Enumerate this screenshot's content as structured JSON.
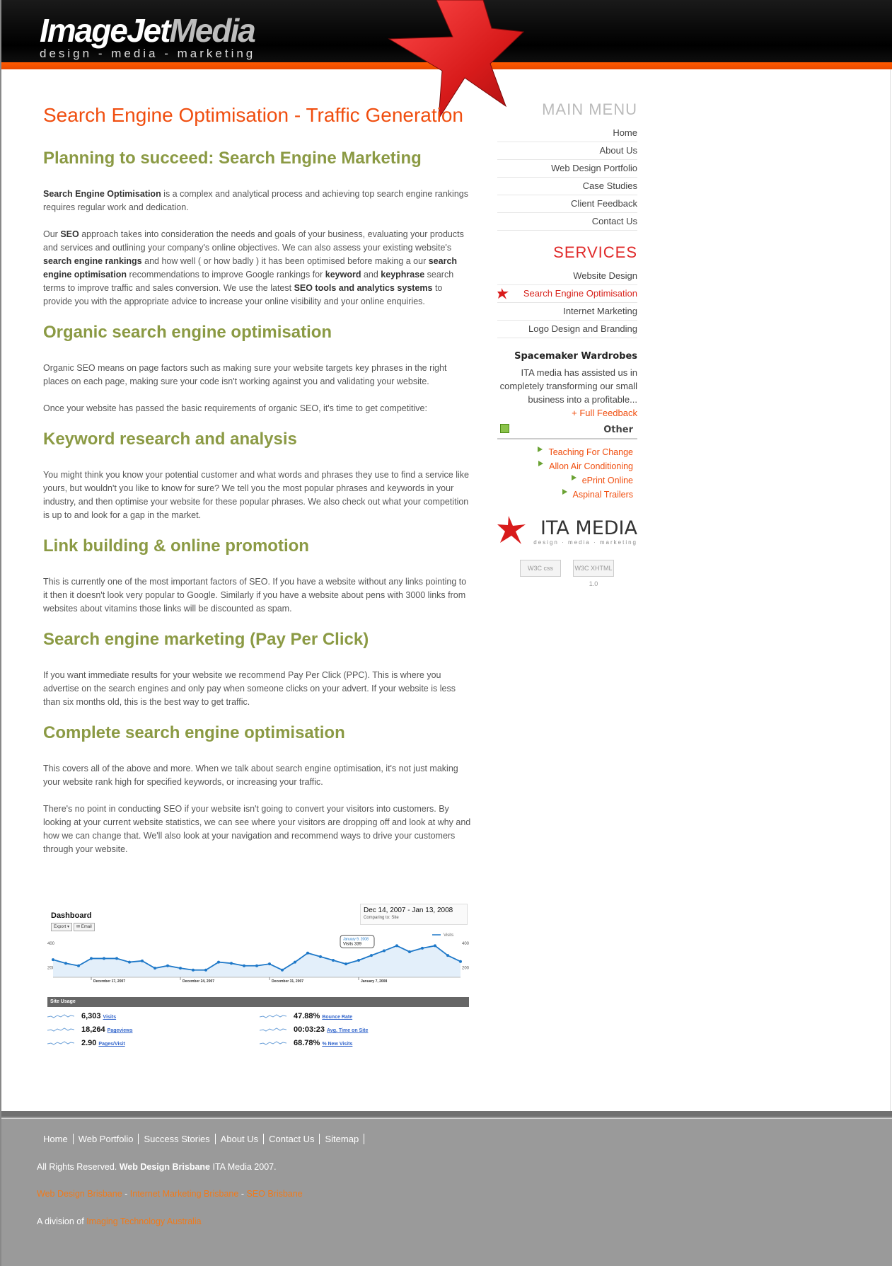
{
  "header": {
    "logo_main": "ImageJet",
    "logo_media": "Media",
    "logo_tagline": "design - media - marketing"
  },
  "main": {
    "page_title": "Search Engine Optimisation - Traffic Generation",
    "sections": [
      {
        "heading": "Planning to succeed: Search Engine Marketing",
        "paragraphs": [
          "<b>Search Engine Optimisation</b> is a complex and analytical process and achieving top search engine rankings requires regular work and dedication.",
          "Our <b>SEO</b> approach takes into consideration the needs and goals of your business, evaluating your products and services and outlining your company's online objectives. We can also assess your existing website's <b>search engine rankings</b> and how well ( or how badly ) it has been optimised before making a our <b>search engine optimisation</b> recommendations to improve Google rankings for <b>keyword</b> and <b>keyphrase</b> search terms to improve traffic and sales conversion. We use the latest <b>SEO tools and analytics systems</b> to provide you with the appropriate advice to increase your online visibility and your online enquiries."
        ]
      },
      {
        "heading": "Organic search engine optimisation",
        "paragraphs": [
          "Organic SEO means on page factors such as making sure your website targets key phrases in the right places on each page, making sure your code isn't working against you and validating your website.",
          "Once your website has passed the basic requirements of organic SEO, it's time to get competitive:"
        ]
      },
      {
        "heading": "Keyword research and analysis",
        "paragraphs": [
          "You might think you know your potential customer and what words and phrases they use to find a service like yours, but wouldn't you like to know for sure? We tell you the most popular phrases and keywords in your industry, and then optimise your website for these popular phrases. We also check out what your competition is up to and look for a gap in the market."
        ]
      },
      {
        "heading": "Link building & online promotion",
        "paragraphs": [
          "This is currently one of the most important factors of SEO. If you have a website without any links pointing to it then it doesn't look very popular to Google. Similarly if you have a website about pens with 3000 links from websites about vitamins those links will be discounted as spam."
        ]
      },
      {
        "heading": "Search engine marketing (Pay Per Click)",
        "paragraphs": [
          "If you want immediate results for your website we recommend Pay Per Click (PPC). This is where you advertise on the search engines and only pay when someone clicks on your advert. If your website is less than six months old, this is the best way to get traffic."
        ]
      },
      {
        "heading": "Complete search engine optimisation",
        "paragraphs": [
          "This covers all of the above and more. When we talk about search engine optimisation, it's not just making your website rank high for specified keywords, or increasing your traffic.",
          "There's no point in conducting SEO if your website isn't going to convert your visitors into customers. By looking at your current website statistics, we can see where your visitors are dropping off and look at why and how we can change that. We'll also look at your navigation and recommend ways to drive your customers through your website."
        ]
      }
    ]
  },
  "dashboard": {
    "title": "Dashboard",
    "export_label": "Export ▾",
    "email_label": "✉ Email",
    "date_range": "Dec 14, 2007 - Jan 13, 2008",
    "comparing": "Comparing to:  Site",
    "legend": "Visits",
    "tooltip_date": "January 9, 2008",
    "tooltip_value": "Visits 339",
    "y_labels": [
      "400",
      "200"
    ],
    "x_labels": [
      "December 17, 2007",
      "December 24, 2007",
      "December 31, 2007",
      "January 7, 2008"
    ],
    "usage_label": "Site Usage",
    "stats": [
      {
        "value": "6,303",
        "label": "Visits"
      },
      {
        "value": "18,264",
        "label": "Pageviews"
      },
      {
        "value": "2.90",
        "label": "Pages/Visit"
      },
      {
        "value": "47.88%",
        "label": "Bounce Rate"
      },
      {
        "value": "00:03:23",
        "label": "Avg. Time on Site"
      },
      {
        "value": "68.78%",
        "label": "% New Visits"
      }
    ]
  },
  "chart_data": {
    "type": "line",
    "series": [
      {
        "name": "Visits",
        "values": [
          265,
          235,
          215,
          275,
          275,
          275,
          245,
          255,
          195,
          215,
          195,
          180,
          180,
          245,
          235,
          215,
          215,
          230,
          180,
          245,
          320,
          290,
          260,
          230,
          260,
          300,
          339,
          380,
          330,
          360,
          380,
          300,
          250
        ]
      }
    ],
    "ylim": [
      0,
      400
    ],
    "x_ticks": [
      "December 17, 2007",
      "December 24, 2007",
      "December 31, 2007",
      "January 7, 2008"
    ]
  },
  "sidebar": {
    "main_menu_heading": "MAIN MENU",
    "main_menu": [
      "Home",
      "About Us",
      "Web Design Portfolio",
      "Case Studies",
      "Client Feedback",
      "Contact Us"
    ],
    "services_heading": "SERVICES",
    "services": [
      "Website Design",
      "Search Engine Optimisation",
      "Internet Marketing",
      "Logo Design and Branding"
    ],
    "testimonial": {
      "title": "Spacemaker Wardrobes",
      "body": "ITA media has assisted us in completely transforming our small business into a profitable...",
      "link": "+ Full Feedback"
    },
    "other_label": "Other",
    "other_links": [
      "Teaching For Change",
      "Allon Air Conditioning",
      "ePrint Online",
      "Aspinal Trailers"
    ],
    "ita_logo": "ITA MEDIA",
    "ita_tagline": "design · media · marketing",
    "w3c_css": "W3C css",
    "w3c_xhtml": "W3C XHTML 1.0"
  },
  "footer": {
    "nav": [
      "Home",
      "Web Portfolio",
      "Success Stories",
      "About Us",
      "Contact Us",
      "Sitemap"
    ],
    "copyright_prefix": "All Rights Reserved. ",
    "copyright_bold": "Web Design Brisbane",
    "copyright_suffix": " ITA Media 2007.",
    "links": [
      "Web Design Brisbane",
      "Internet Marketing Brisbane",
      "SEO Brisbane"
    ],
    "division_prefix": "A division of ",
    "division_link": "Imaging Technology Australia"
  }
}
